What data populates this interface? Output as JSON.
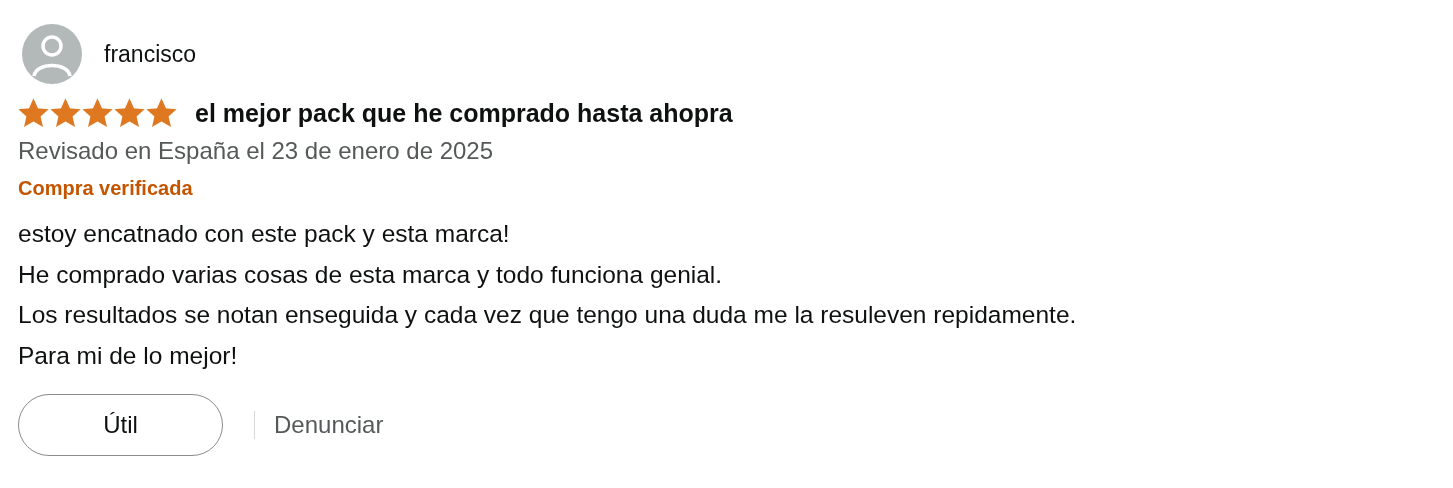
{
  "review": {
    "author": "francisco",
    "stars": 5,
    "title": "el mejor pack que he comprado hasta ahopra",
    "date": "Revisado en España el 23 de enero de 2025",
    "badge": "Compra verificada",
    "body": [
      "estoy encatnado con este pack y esta marca!",
      "He comprado varias cosas de esta marca y todo funciona genial.",
      "Los resultados se notan enseguida y cada vez que tengo una duda me la resuleven repidamente.",
      "Para mi de lo mejor!"
    ],
    "helpful_button": "Útil",
    "report_link": "Denunciar"
  }
}
